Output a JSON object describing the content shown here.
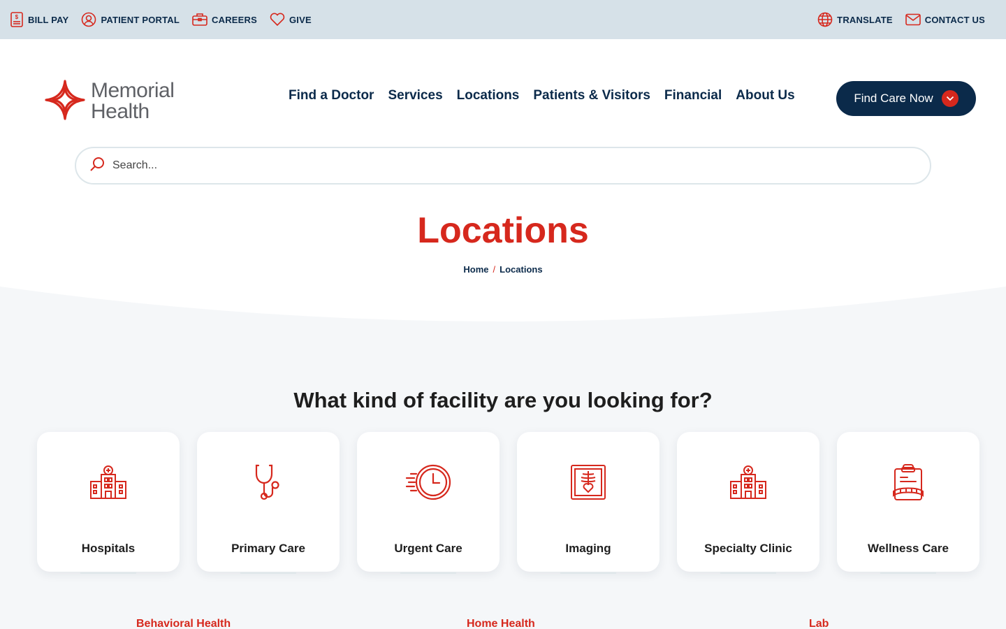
{
  "utility_bar": {
    "left_links": [
      {
        "label": "BILL PAY",
        "icon": "bill-icon"
      },
      {
        "label": "PATIENT PORTAL",
        "icon": "user-circle-icon"
      },
      {
        "label": "CAREERS",
        "icon": "briefcase-icon"
      },
      {
        "label": "GIVE",
        "icon": "heart-icon"
      }
    ],
    "right_links": [
      {
        "label": "TRANSLATE",
        "icon": "globe-icon"
      },
      {
        "label": "CONTACT US",
        "icon": "envelope-icon"
      }
    ]
  },
  "brand": {
    "name_line1": "Memorial",
    "name_line2": "Health",
    "accent_color": "#d6281d",
    "navy_color": "#0b2a4a"
  },
  "nav": {
    "items": [
      "Find a Doctor",
      "Services",
      "Locations",
      "Patients & Visitors",
      "Financial",
      "About Us"
    ],
    "cta_label": "Find Care Now"
  },
  "search": {
    "placeholder": "Search..."
  },
  "page": {
    "title": "Locations",
    "breadcrumb": [
      "Home",
      "Locations"
    ],
    "breadcrumb_separator": "/"
  },
  "facilities": {
    "heading": "What kind of facility are you looking for?",
    "cards": [
      {
        "label": "Hospitals",
        "icon": "hospital-icon"
      },
      {
        "label": "Primary Care",
        "icon": "stethoscope-icon"
      },
      {
        "label": "Urgent Care",
        "icon": "fast-clock-icon"
      },
      {
        "label": "Imaging",
        "icon": "xray-icon"
      },
      {
        "label": "Specialty Clinic",
        "icon": "clinic-icon"
      },
      {
        "label": "Wellness Care",
        "icon": "clipboard-tape-icon"
      }
    ],
    "more_links": [
      "Behavioral Health",
      "Home Health",
      "Lab"
    ]
  }
}
